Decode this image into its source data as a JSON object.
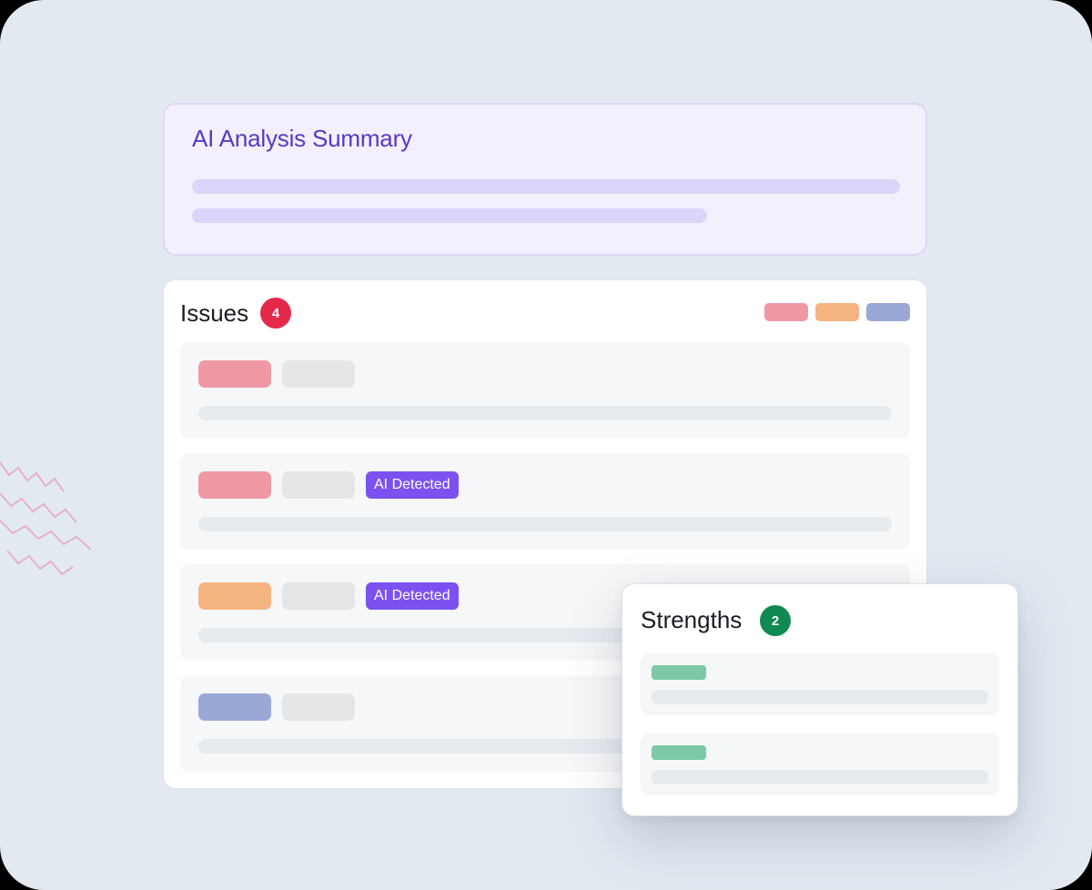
{
  "summary": {
    "title": "AI Analysis Summary"
  },
  "issues": {
    "title": "Issues",
    "count": "4",
    "legend_colors": [
      "#f097a5",
      "#f4b480",
      "#9aa8d6"
    ],
    "ai_tag_label": "AI Detected",
    "rows": [
      {
        "severity_color": "#f097a5",
        "ai_detected": false
      },
      {
        "severity_color": "#f097a5",
        "ai_detected": true
      },
      {
        "severity_color": "#f4b480",
        "ai_detected": true
      },
      {
        "severity_color": "#9aa8d6",
        "ai_detected": false
      }
    ]
  },
  "strengths": {
    "title": "Strengths",
    "count": "2",
    "pill_color": "#7dc8a5"
  },
  "colors": {
    "background": "#e2e9f1",
    "summary_accent": "#5b37c6",
    "issues_badge": "#e5294b",
    "strengths_badge": "#0e8a52",
    "ai_tag": "#7b52ef"
  }
}
